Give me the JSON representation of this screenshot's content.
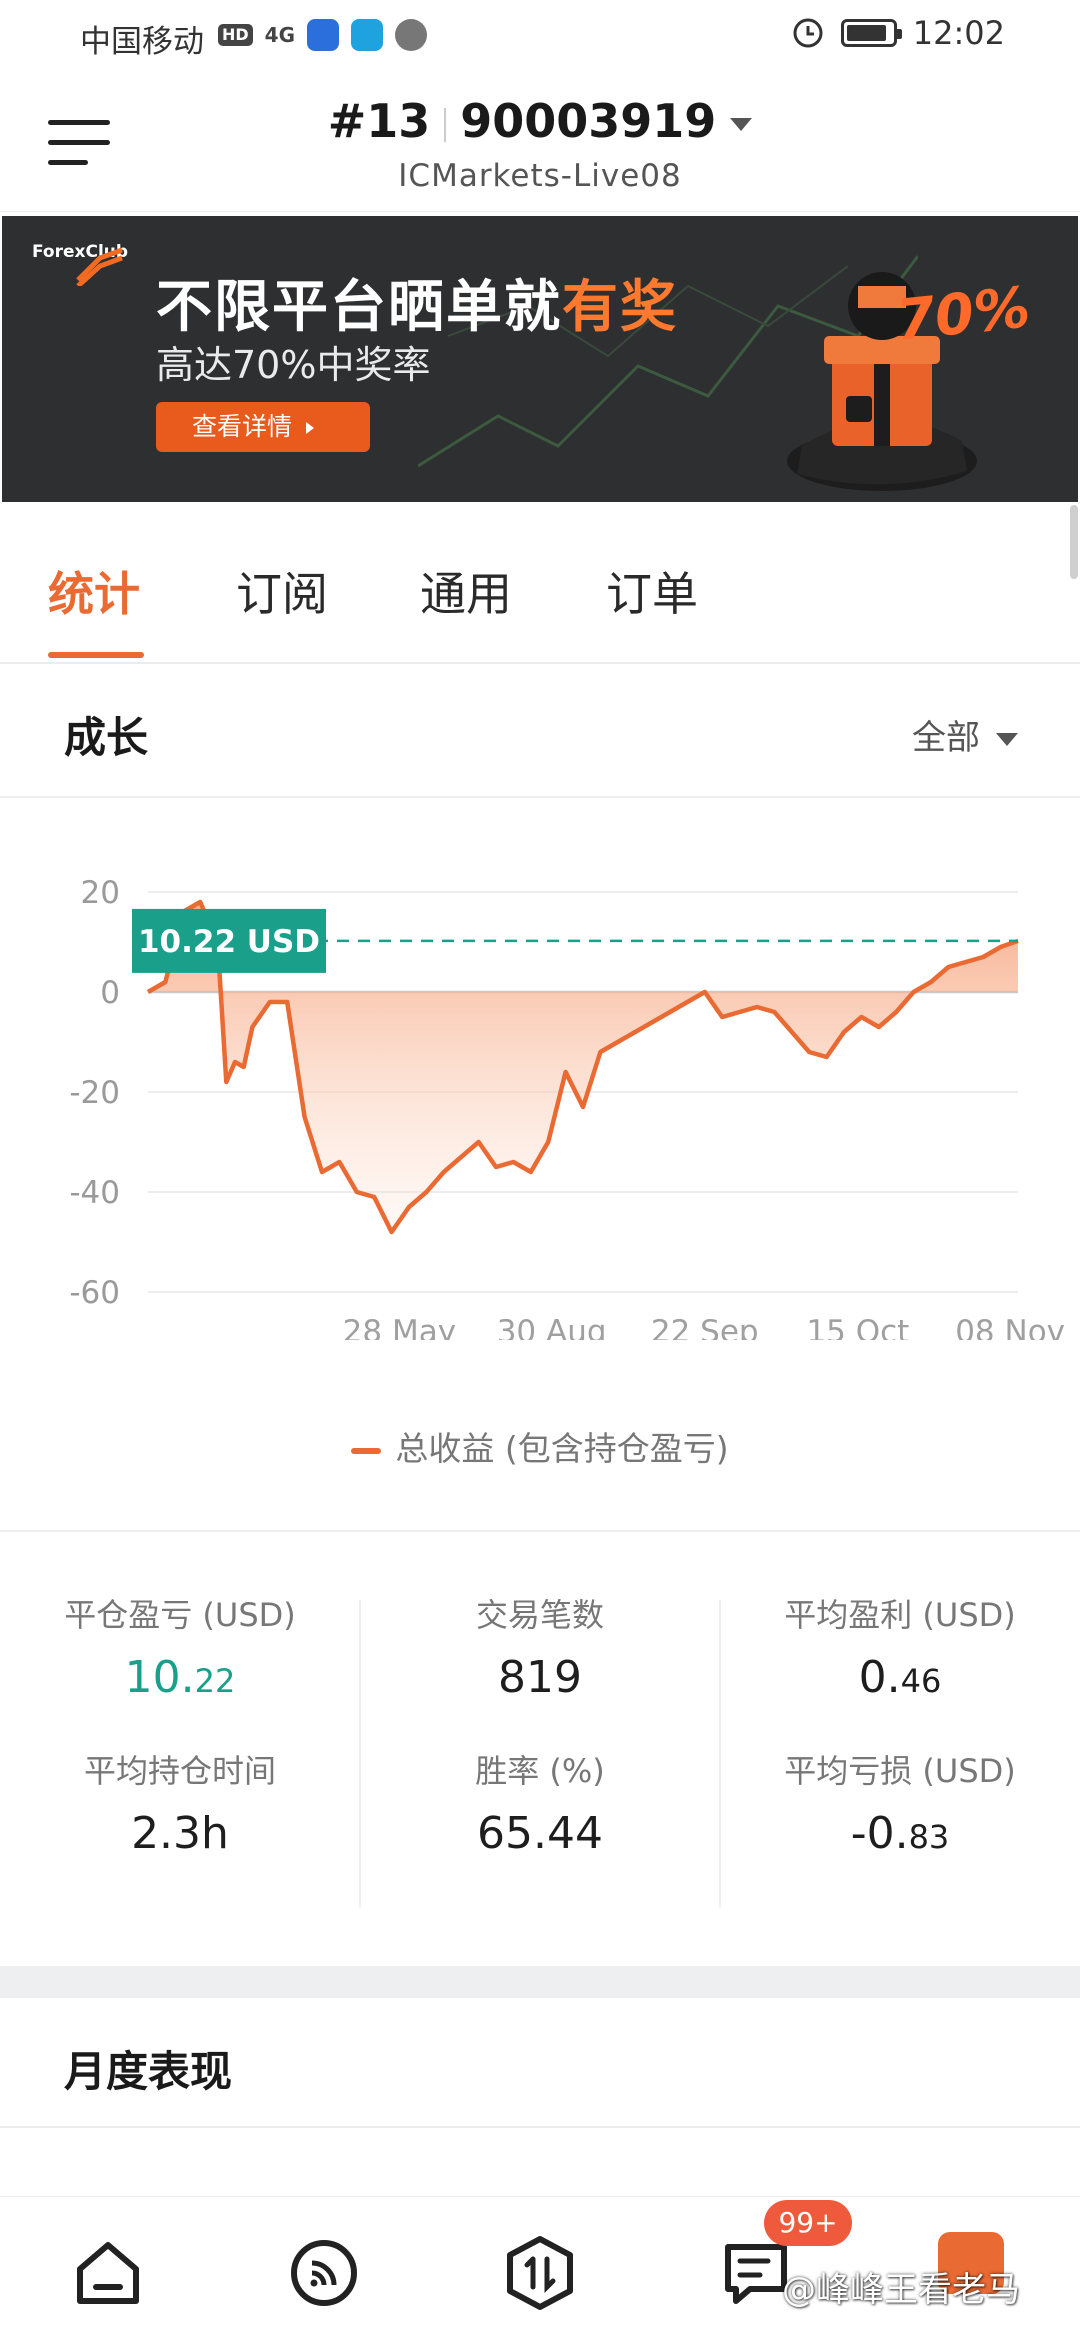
{
  "status_bar": {
    "carrier": "中国移动",
    "hd_badge": "HD",
    "signal": "4G",
    "time": "12:02",
    "battery_level": 0.9
  },
  "header": {
    "account_rank": "#13",
    "account_number": "90003919",
    "server": "ICMarkets-Live08"
  },
  "banner": {
    "logo_text": "ForexClub",
    "title_plain": "不限平台晒单就",
    "title_highlight": "有奖",
    "subtitle": "高达70%中奖率",
    "button_label": "查看详情",
    "badge": "70%",
    "accent_color": "#ff7a2e"
  },
  "tabs": [
    {
      "label": "统计",
      "active": true
    },
    {
      "label": "订阅",
      "active": false
    },
    {
      "label": "通用",
      "active": false
    },
    {
      "label": "订单",
      "active": false
    }
  ],
  "growth": {
    "title": "成长",
    "filter_label": "全部"
  },
  "chart_data": {
    "type": "area",
    "y_ticks": [
      "20",
      "0",
      "-20",
      "-40",
      "-60"
    ],
    "ylim": [
      -60,
      20
    ],
    "x_tick_labels": [
      "28 May",
      "30 Aug",
      "22 Sep",
      "15 Oct",
      "08 Nov"
    ],
    "current_value_label": "10.22 USD",
    "current_value": 10.22,
    "line_color": "#ea6a33",
    "reference_line_color": "#1aa08a",
    "series": [
      {
        "name": "总收益 (包含持仓盈亏)",
        "x_index": [
          0,
          2,
          4,
          6,
          8,
          9,
          10,
          11,
          12,
          14,
          16,
          18,
          20,
          22,
          24,
          26,
          28,
          30,
          32,
          34,
          36,
          38,
          40,
          42,
          44,
          46,
          48,
          50,
          52,
          54,
          56,
          58,
          60,
          62,
          64,
          66,
          68,
          70,
          72,
          74,
          76,
          78,
          80,
          82,
          84,
          86,
          88,
          90,
          92,
          94,
          96,
          98,
          100
        ],
        "values": [
          0,
          2,
          16,
          18,
          10,
          -18,
          -14,
          -15,
          -7,
          -2,
          -2,
          -25,
          -36,
          -34,
          -40,
          -41,
          -48,
          -43,
          -40,
          -36,
          -33,
          -30,
          -35,
          -34,
          -36,
          -30,
          -16,
          -23,
          -12,
          -10,
          -8,
          -6,
          -4,
          -2,
          0,
          -5,
          -4,
          -3,
          -4,
          -8,
          -12,
          -13,
          -8,
          -5,
          -7,
          -4,
          0,
          2,
          5,
          6,
          7,
          9,
          10.22
        ]
      }
    ],
    "legend_position": "bottom",
    "grid": true
  },
  "stats": {
    "closed_pnl": {
      "label": "平仓盈亏 (USD)",
      "int": "10.",
      "frac": "22"
    },
    "trades": {
      "label": "交易笔数",
      "value": "819"
    },
    "avg_profit": {
      "label": "平均盈利 (USD)",
      "int": "0.",
      "frac": "46"
    },
    "avg_hold": {
      "label": "平均持仓时间",
      "value": "2.3h"
    },
    "win_rate": {
      "label": "胜率 (%)",
      "value": "65.44"
    },
    "avg_loss": {
      "label": "平均亏损 (USD)",
      "int": "-0.",
      "frac": "83"
    }
  },
  "monthly": {
    "title": "月度表现"
  },
  "bottom_nav": {
    "items": [
      "home-icon",
      "feed-icon",
      "trade-icon",
      "messages-icon",
      "profile-icon"
    ],
    "badge": "99+"
  },
  "watermark": "@峰峰王看老马"
}
